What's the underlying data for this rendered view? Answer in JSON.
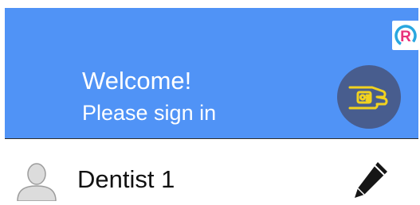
{
  "header": {
    "title": "Welcome!",
    "subtitle": "Please sign in",
    "background_color": "#5093f6",
    "logo_letter": "R",
    "logo_icon": "r-logo-icon",
    "card_button_icon": "hand-holding-card-icon"
  },
  "user": {
    "name": "Dentist 1",
    "avatar_icon": "user-avatar-icon",
    "edit_icon": "pencil-icon"
  }
}
